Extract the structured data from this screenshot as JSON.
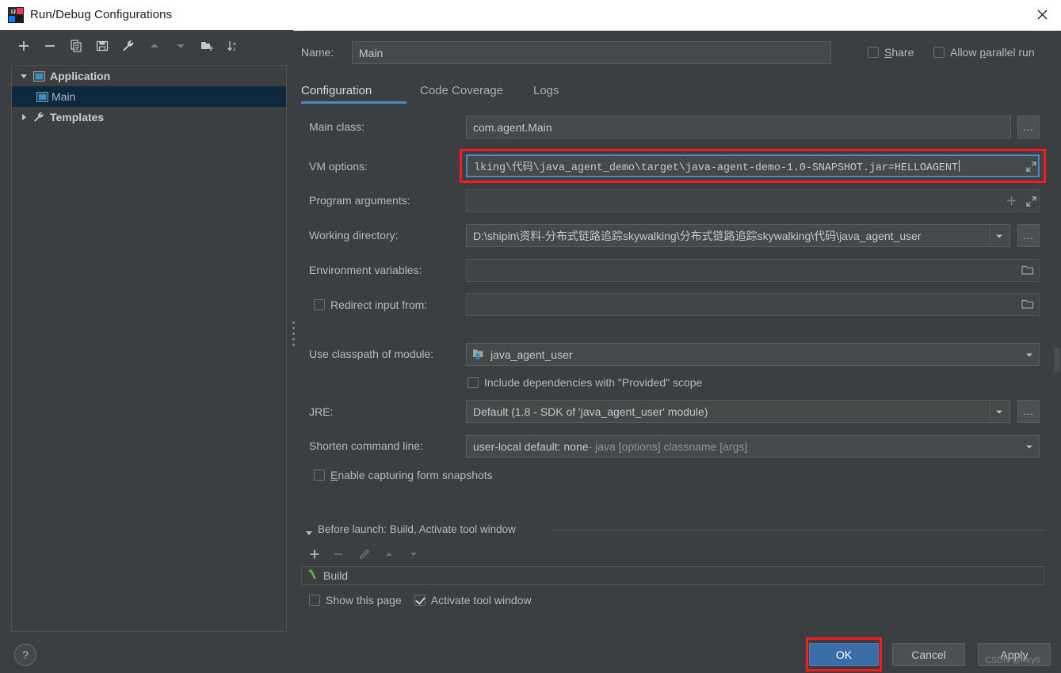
{
  "window": {
    "title": "Run/Debug Configurations",
    "app_icon": "intellij-idea-icon",
    "close_icon": "close-icon"
  },
  "left_panel": {
    "toolbar": [
      {
        "name": "add-configuration-button",
        "icon": "plus-icon",
        "label": "+"
      },
      {
        "name": "remove-configuration-button",
        "icon": "minus-icon",
        "label": "−"
      },
      {
        "name": "copy-configuration-button",
        "icon": "copy-icon",
        "label": "Copy"
      },
      {
        "name": "save-configuration-button",
        "icon": "save-icon",
        "label": "Save"
      },
      {
        "name": "edit-templates-button",
        "icon": "wrench-icon",
        "label": "Edit Templates"
      },
      {
        "name": "move-up-button",
        "icon": "arrow-up-icon",
        "label": "Move Up"
      },
      {
        "name": "move-down-button",
        "icon": "arrow-down-icon",
        "label": "Move Down"
      },
      {
        "name": "new-folder-button",
        "icon": "folder-add-icon",
        "label": "New Folder"
      },
      {
        "name": "sort-button",
        "icon": "sort-alpha-icon",
        "label": "Sort Configurations"
      }
    ],
    "tree": [
      {
        "label": "Application",
        "icon": "application-icon",
        "arrow": "expanded",
        "level": 0,
        "selected": false
      },
      {
        "label": "Main",
        "icon": "application-icon",
        "arrow": "none",
        "level": 1,
        "selected": true
      },
      {
        "label": "Templates",
        "icon": "wrench-icon",
        "arrow": "collapsed",
        "level": 0,
        "selected": false
      }
    ]
  },
  "right_panel": {
    "name_label": "Name:",
    "name_value": "Main",
    "share": {
      "label": "Share",
      "mnemonic": "S",
      "checked": false
    },
    "allow_parallel": {
      "label": "Allow parallel run",
      "mnemonic": "p",
      "checked": false
    },
    "tabs": [
      {
        "label": "Configuration",
        "active": true
      },
      {
        "label": "Code Coverage",
        "active": false
      },
      {
        "label": "Logs",
        "active": false
      }
    ],
    "fields": {
      "main_class": {
        "label": "Main class:",
        "value": "com.agent.Main",
        "browse": "..."
      },
      "vm_options": {
        "label": "VM options:",
        "value": "lking\\代码\\java_agent_demo\\target\\java-agent-demo-1.0-SNAPSHOT.jar=HELLOAGENT",
        "focused": true,
        "highlighted": true,
        "expand_icon": "expand-editor-icon"
      },
      "program_arguments": {
        "label": "Program arguments:",
        "value": "",
        "plus_icon": "insert-macro-icon",
        "expand_icon": "expand-editor-icon"
      },
      "working_directory": {
        "label": "Working directory:",
        "value": "D:\\shipin\\资料-分布式链路追踪skywalking\\分布式链路追踪skywalking\\代码\\java_agent_user",
        "browse": "..."
      },
      "environment_variables": {
        "label": "Environment variables:",
        "value": "",
        "folder_icon": "folder-icon"
      },
      "redirect_input": {
        "label": "Redirect input from:",
        "checked": false,
        "value": "",
        "folder_icon": "folder-icon"
      },
      "use_classpath_of_module": {
        "label": "Use classpath of module:",
        "value": "java_agent_user",
        "icon": "module-icon"
      },
      "include_provided": {
        "label": "Include dependencies with \"Provided\" scope",
        "checked": false
      },
      "jre": {
        "label": "JRE:",
        "value": "Default (1.8 - SDK of 'java_agent_user' module)",
        "browse": "..."
      },
      "shorten_command_line": {
        "label": "Shorten command line:",
        "value_bold": "user-local default: none",
        "value_rest": " - java [options] classname [args]"
      },
      "enable_capturing": {
        "label": "Enable capturing form snapshots",
        "mnemonic": "E",
        "checked": false
      }
    },
    "before_launch": {
      "title": "Before launch: Build, Activate tool window",
      "arrow": "expanded",
      "toolbar": [
        {
          "name": "add-task-button",
          "icon": "plus-icon",
          "label": "+"
        },
        {
          "name": "remove-task-button",
          "icon": "minus-icon",
          "label": "−"
        },
        {
          "name": "edit-task-button",
          "icon": "pencil-icon",
          "label": "Edit"
        },
        {
          "name": "move-task-up-button",
          "icon": "arrow-up-icon",
          "label": "Up"
        },
        {
          "name": "move-task-down-button",
          "icon": "arrow-down-icon",
          "label": "Down"
        }
      ],
      "tasks": [
        {
          "label": "Build",
          "icon": "build-hammer-icon"
        }
      ],
      "show_this_page": {
        "label": "Show this page",
        "checked": false
      },
      "activate_tool_window": {
        "label": "Activate tool window",
        "checked": true
      }
    }
  },
  "bottom_bar": {
    "help": "?",
    "ok": "OK",
    "cancel": "Cancel",
    "apply": "Apply",
    "watermark": "CSDN @mry6"
  },
  "colors": {
    "dialog_bg": "#3c3f41",
    "titlebar_bg": "#ffffff",
    "field_bg": "#45494a",
    "accent_blue": "#4a88c7",
    "primary_button": "#3b6ea8",
    "selection_blue": "#0d293e",
    "highlight_red": "#ff1a1a",
    "text": "#bbbbbb"
  }
}
